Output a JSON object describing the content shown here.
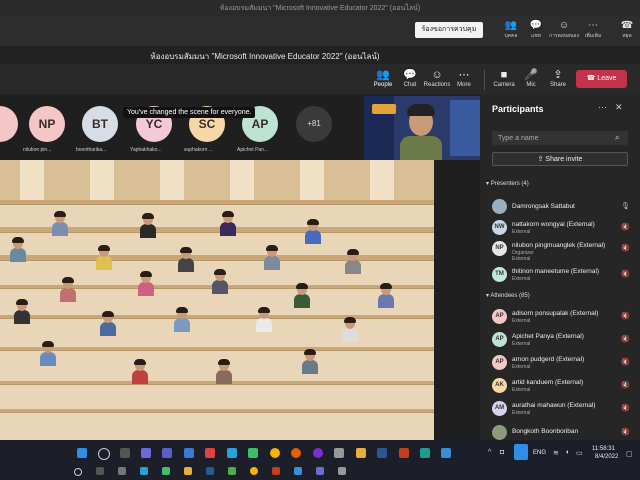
{
  "window": {
    "title": "ห้องอบรมสัมมนา \"Microsoft Innovative Educator 2022\" (ออนไลน์)"
  },
  "toolbar1": {
    "request_button": "ร้องขอการควบคุม",
    "icons": [
      {
        "icon": "people-icon",
        "label": "บุคคล"
      },
      {
        "icon": "chat-icon",
        "label": "แชท"
      },
      {
        "icon": "reactions-icon",
        "label": "การตอบสนอง"
      },
      {
        "icon": "more-icon",
        "label": "เพิ่มเติม"
      },
      {
        "icon": "leave-icon",
        "label": "หยุด"
      }
    ]
  },
  "meeting": {
    "title": "ห้องอบรมสัมมนา \"Microsoft Innovative Educator 2022\" (ออนไลน์)"
  },
  "controls": {
    "people": "People",
    "chat": "Chat",
    "reactions": "Reactions",
    "more": "More",
    "camera": "Camera",
    "mic": "Mic",
    "share": "Share",
    "leave": "Leave"
  },
  "strip": {
    "toast": "You've changed the scene for everyone.",
    "more_count": "+81",
    "avatars": [
      {
        "initials": "NP",
        "name": "nilubon pin...",
        "color": "#f4c6c6"
      },
      {
        "initials": "BT",
        "name": "boontharika...",
        "color": "#d6dde6"
      },
      {
        "initials": "YC",
        "name": "Yaphakhako...",
        "color": "#f3c8d8"
      },
      {
        "initials": "SC",
        "name": "suphakorn ...",
        "color": "#f6d7a8"
      },
      {
        "initials": "AP",
        "name": "Apichet Pan...",
        "color": "#bfe3d2"
      }
    ]
  },
  "participants": {
    "title": "Participants",
    "search_placeholder": "Type a name",
    "share_invite": "Share invite",
    "presenters_header": "Presenters (4)",
    "attendees_header": "Attendees (85)",
    "presenters": [
      {
        "initials": "",
        "name": "Damrongsak Sattabut",
        "role": "",
        "color": "#9ab0c0"
      },
      {
        "initials": "NW",
        "name": "nattakorn wongyai (External)",
        "role": "External",
        "color": "#c9d7e6"
      },
      {
        "initials": "NP",
        "name": "nilubon pingmuanglek (External)",
        "role": "Organizer",
        "role2": "External",
        "color": "#e6e6e6"
      },
      {
        "initials": "TM",
        "name": "thitinon maneetume (External)",
        "role": "External",
        "color": "#c6e6d9"
      }
    ],
    "attendees": [
      {
        "initials": "AP",
        "name": "adisorn ponsupalak (External)",
        "role": "External",
        "color": "#f4c6c6"
      },
      {
        "initials": "AP",
        "name": "Apichet Panya (External)",
        "role": "External",
        "color": "#bfe3d2"
      },
      {
        "initials": "AP",
        "name": "arnon pudgerd (External)",
        "role": "External",
        "color": "#f4c6c6"
      },
      {
        "initials": "AK",
        "name": "artid kanduem (External)",
        "role": "External",
        "color": "#f6d7a8"
      },
      {
        "initials": "AM",
        "name": "aurathai mahawun (External)",
        "role": "External",
        "color": "#d7d3ee"
      },
      {
        "initials": "",
        "name": "Bongkoth Boonboriban",
        "role": "",
        "color": "#8a9a7a"
      }
    ]
  },
  "taskbar": {
    "language": "ENG",
    "time": "11:58:31",
    "date": "8/4/2022"
  }
}
